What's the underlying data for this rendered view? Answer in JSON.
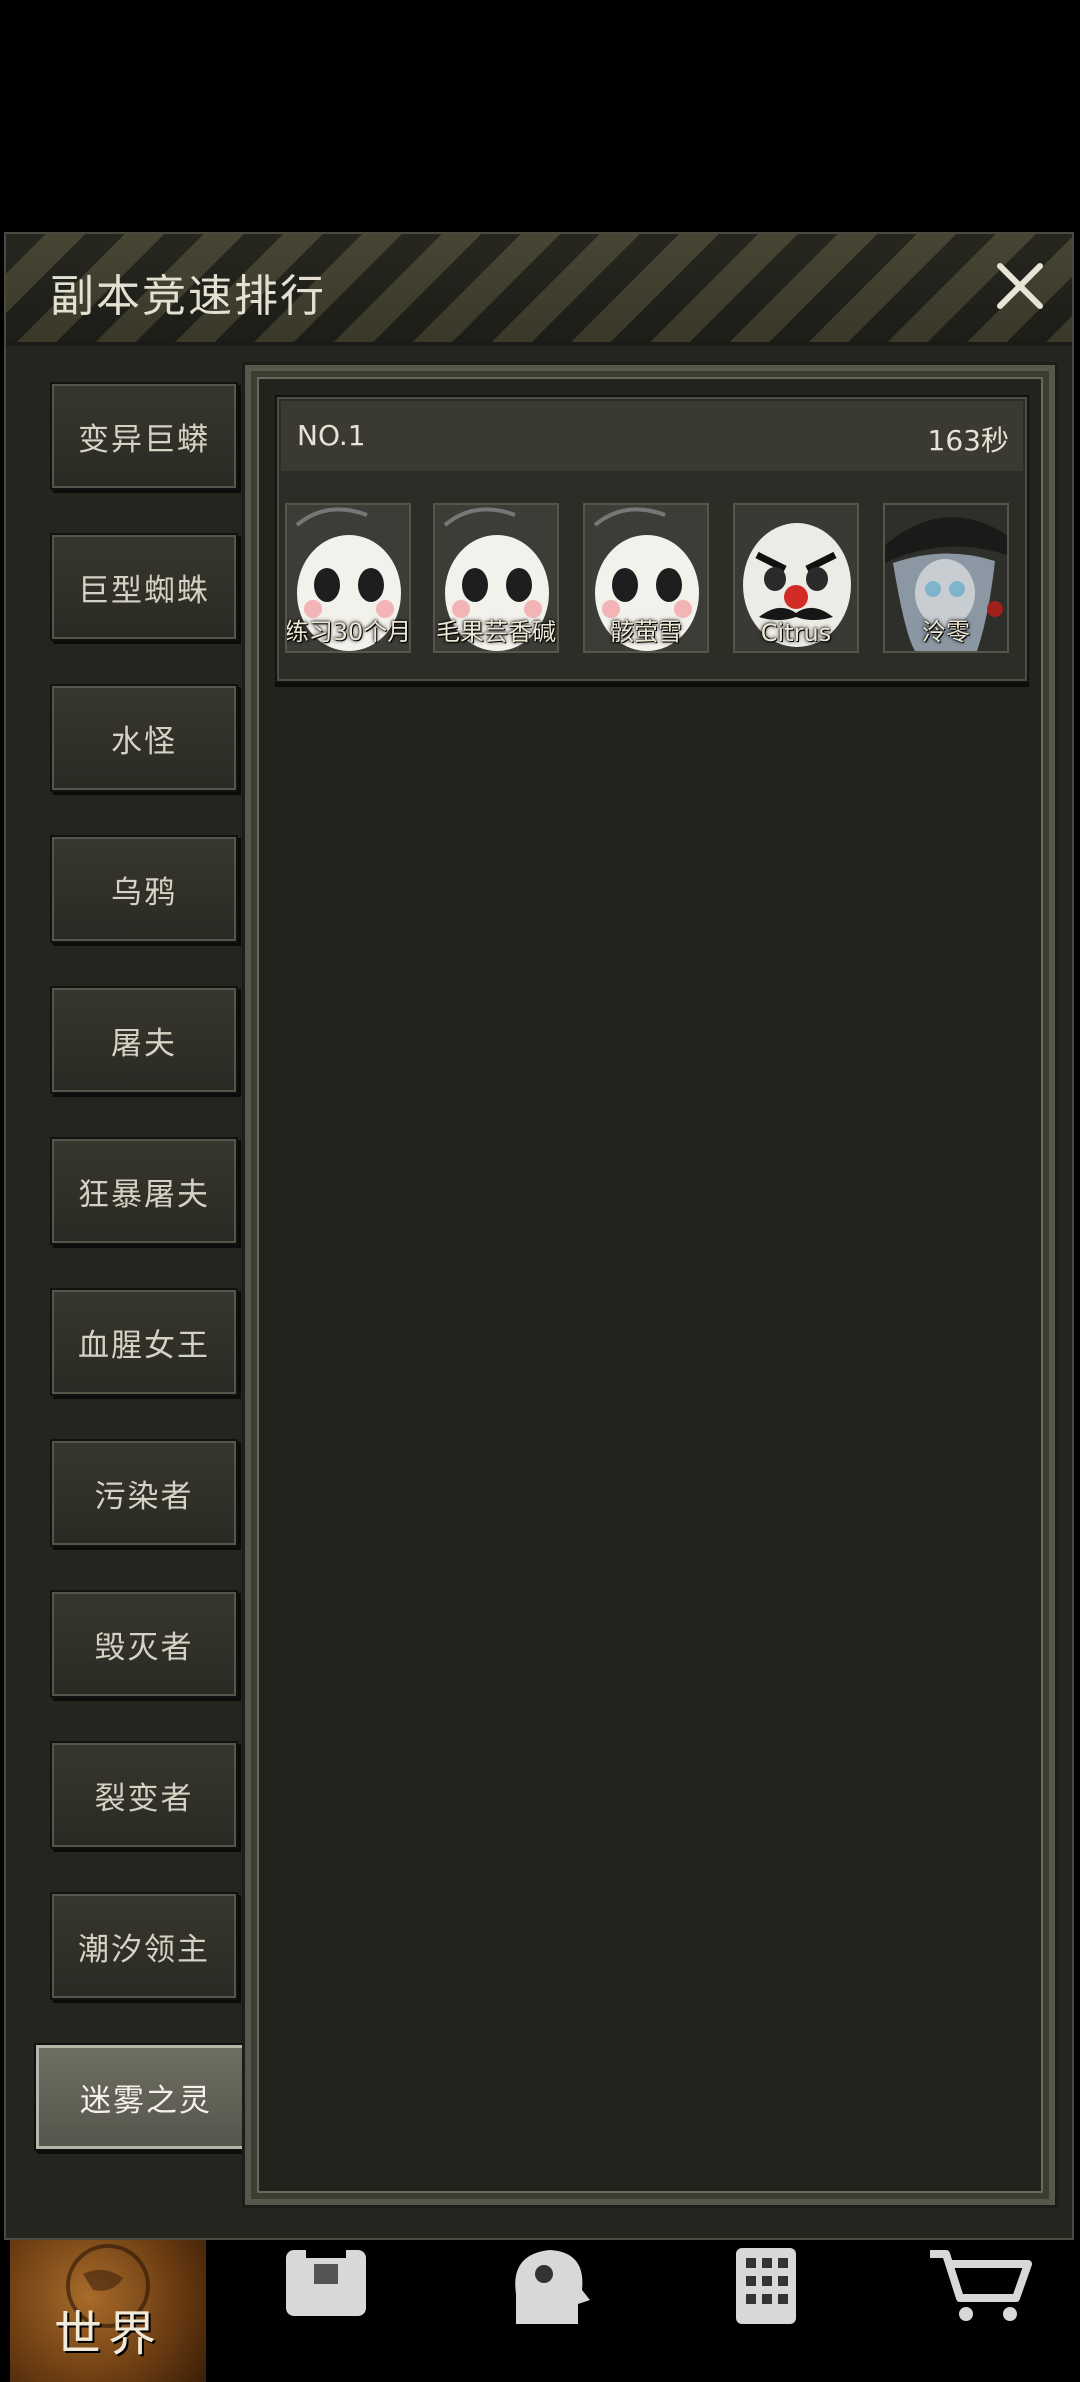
{
  "dialog": {
    "title": "副本竞速排行",
    "close_icon": "close-icon"
  },
  "categories": [
    {
      "label": "变异巨蟒",
      "active": false
    },
    {
      "label": "巨型蜘蛛",
      "active": false
    },
    {
      "label": "水怪",
      "active": false
    },
    {
      "label": "乌鸦",
      "active": false
    },
    {
      "label": "屠夫",
      "active": false
    },
    {
      "label": "狂暴屠夫",
      "active": false
    },
    {
      "label": "血腥女王",
      "active": false
    },
    {
      "label": "污染者",
      "active": false
    },
    {
      "label": "毁灭者",
      "active": false
    },
    {
      "label": "裂变者",
      "active": false
    },
    {
      "label": "潮汐领主",
      "active": false
    },
    {
      "label": "迷雾之灵",
      "active": true
    }
  ],
  "ranking": [
    {
      "rank": "NO.1",
      "time": "163秒",
      "players": [
        {
          "name": "练习30个月",
          "avatar": "white-mask-avatar"
        },
        {
          "name": "毛果芸香碱",
          "avatar": "white-mask-avatar"
        },
        {
          "name": "骸萤雪",
          "avatar": "white-mask-avatar"
        },
        {
          "name": "Citrus",
          "avatar": "clown-mask-avatar"
        },
        {
          "name": "泠零",
          "avatar": "pirate-girl-avatar"
        }
      ]
    }
  ],
  "navbar": {
    "world_label": "世界",
    "items": [
      "globe-icon",
      "backpack-icon",
      "head-icon",
      "building-icon",
      "cart-icon"
    ]
  },
  "colors": {
    "panel_bg": "#25251f",
    "active_tab": "#6e6e63",
    "accent_orange": "#a86b2a"
  }
}
